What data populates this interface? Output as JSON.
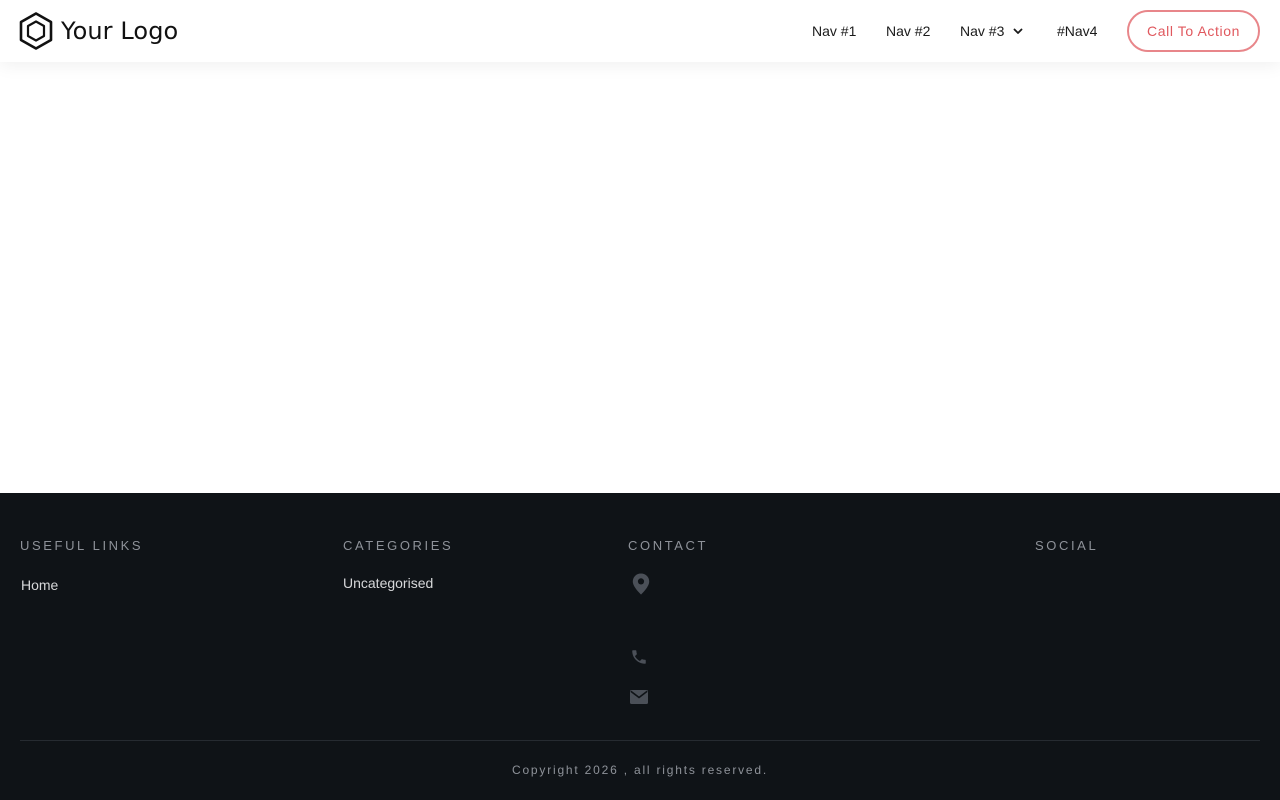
{
  "header": {
    "logo_text": "Your Logo",
    "logo_icon": "hexagon-logo-icon",
    "nav": [
      {
        "label": "Nav #1"
      },
      {
        "label": "Nav #2"
      },
      {
        "label": "Nav #3",
        "has_dropdown": true
      },
      {
        "label": "#Nav4"
      }
    ],
    "cta_label": "Call To Action"
  },
  "footer": {
    "useful_links": {
      "title": "USEFUL LINKS",
      "items": [
        "Home"
      ]
    },
    "categories": {
      "title": "CATEGORIES",
      "items": [
        "Uncategorised"
      ]
    },
    "contact": {
      "title": "CONTACT",
      "icons": [
        "map-pin-icon",
        "phone-icon",
        "envelope-icon"
      ]
    },
    "social": {
      "title": "SOCIAL"
    },
    "copyright": "Copyright 2026 , all rights reserved."
  },
  "colors": {
    "accent": "#e0585e",
    "footer_bg": "#0f1317",
    "footer_heading": "#8e9299",
    "footer_link": "#d6d7d9",
    "footer_icon": "#4b5058"
  }
}
